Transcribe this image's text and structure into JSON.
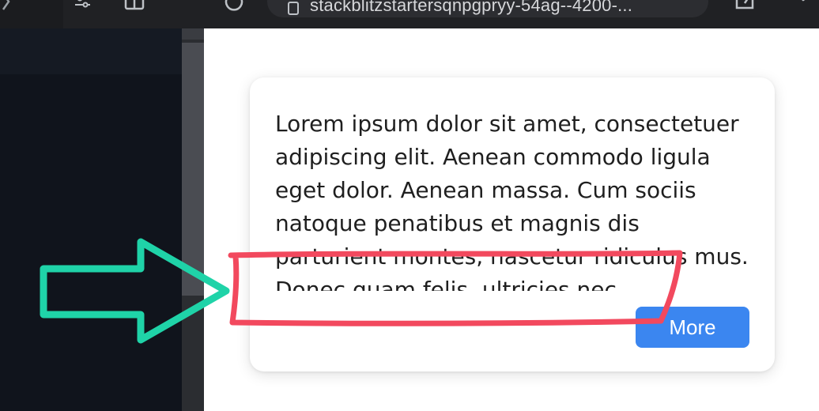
{
  "browser": {
    "url": "stackblitzstartersqnpgpryy-54ag--4200-..."
  },
  "card": {
    "text": "Lorem ipsum dolor sit amet, consectetuer adipiscing elit. Aenean commodo ligula eget dolor. Aenean massa. Cum sociis natoque penatibus et magnis dis parturient montes, nascetur ridiculus mus. Donec quam felis, ultricies nec, pellentesque eu, pretium quis, sem.",
    "more_label": "More"
  },
  "colors": {
    "button_blue": "#3b86f0",
    "arrow_teal": "#1fd3a8",
    "highlight_red": "#f2495e",
    "editor_bg": "#10141c"
  },
  "icons": [
    "chevron-icon",
    "sliders-icon",
    "tab-icon",
    "refresh-icon",
    "lock-icon",
    "share-icon",
    "pointer-icon"
  ]
}
